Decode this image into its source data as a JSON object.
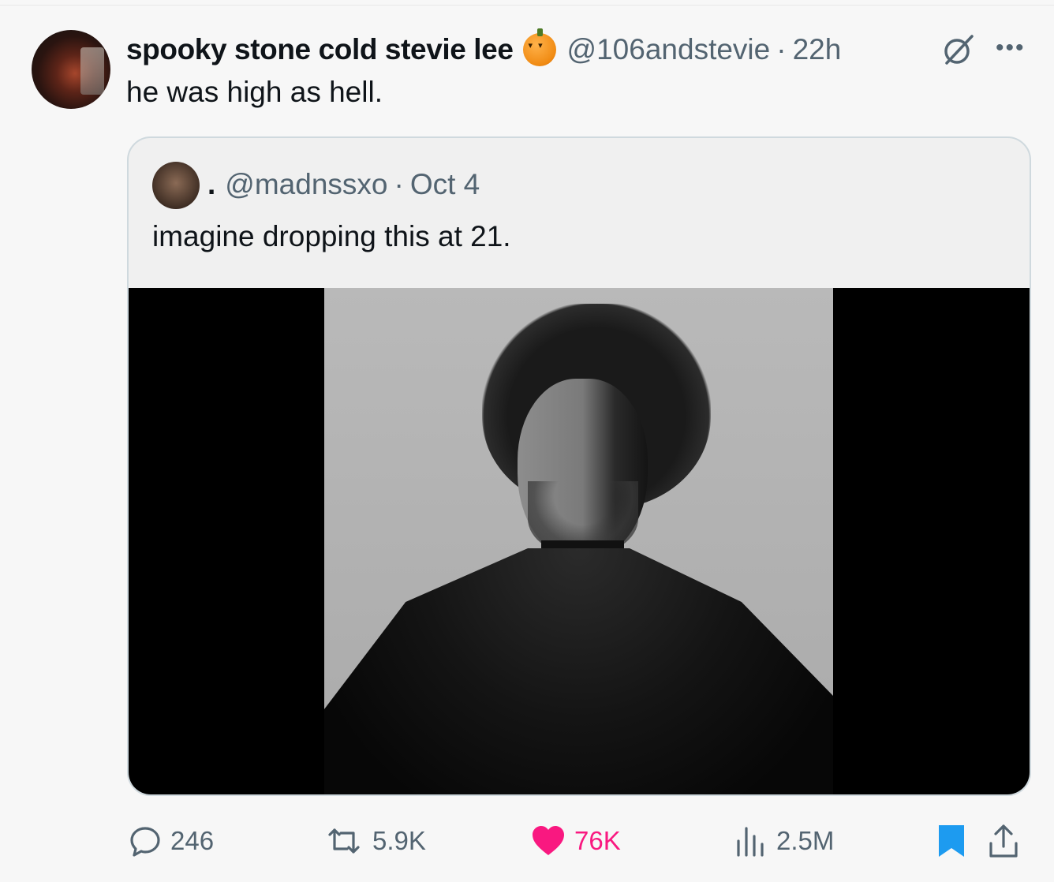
{
  "tweet": {
    "display_name": "spooky stone cold stevie lee",
    "handle": "@106andstevie",
    "separator": "·",
    "time": "22h",
    "text": "he was high as hell."
  },
  "quoted_tweet": {
    "display_name": ".",
    "handle": "@madnssxo",
    "separator": "·",
    "date": "Oct 4",
    "text": "imagine dropping this at 21."
  },
  "actions": {
    "replies": "246",
    "reposts": "5.9K",
    "likes": "76K",
    "views": "2.5M"
  },
  "icons": {
    "name_emoji": "jack-o-lantern-icon",
    "grok": "grok-icon",
    "more": "more-icon",
    "reply": "reply-icon",
    "repost": "repost-icon",
    "like": "heart-icon",
    "views": "views-icon",
    "bookmark": "bookmark-icon",
    "share": "share-icon"
  },
  "colors": {
    "like_active": "#f91880",
    "bookmark_active": "#1d9bf0",
    "secondary_text": "#536471"
  }
}
